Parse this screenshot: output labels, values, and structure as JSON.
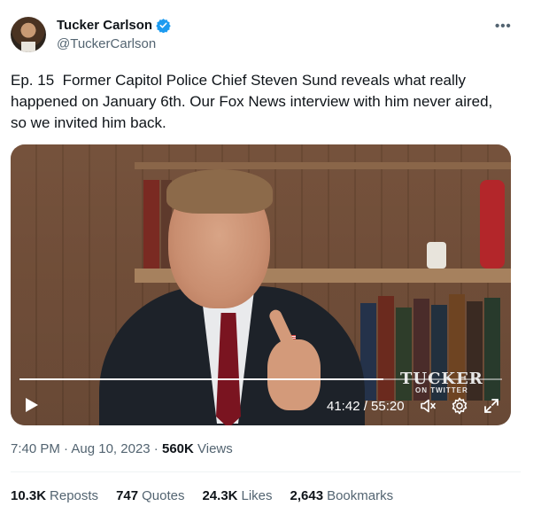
{
  "author": {
    "name": "Tucker Carlson",
    "handle": "@TuckerCarlson"
  },
  "more_label": "•••",
  "tweet": {
    "text": "Ep. 15  Former Capitol Police Chief Steven Sund reveals what really happened on January 6th. Our Fox News interview with him never aired, so we invited him back."
  },
  "video": {
    "time": "41:42 / 55:20",
    "progress_fraction": 0.754,
    "watermark_main": "TUCKER",
    "watermark_sub": "ON TWITTER"
  },
  "meta": {
    "time": "7:40 PM",
    "sep1": " · ",
    "date": "Aug 10, 2023",
    "sep2": " · ",
    "views_count": "560K",
    "views_label": "Views"
  },
  "stats": {
    "reposts_count": "10.3K",
    "reposts_label": "Reposts",
    "quotes_count": "747",
    "quotes_label": "Quotes",
    "likes_count": "24.3K",
    "likes_label": "Likes",
    "bookmarks_count": "2,643",
    "bookmarks_label": "Bookmarks"
  },
  "colors": {
    "verified": "#1d9bf0",
    "secondary_text": "#536471"
  }
}
